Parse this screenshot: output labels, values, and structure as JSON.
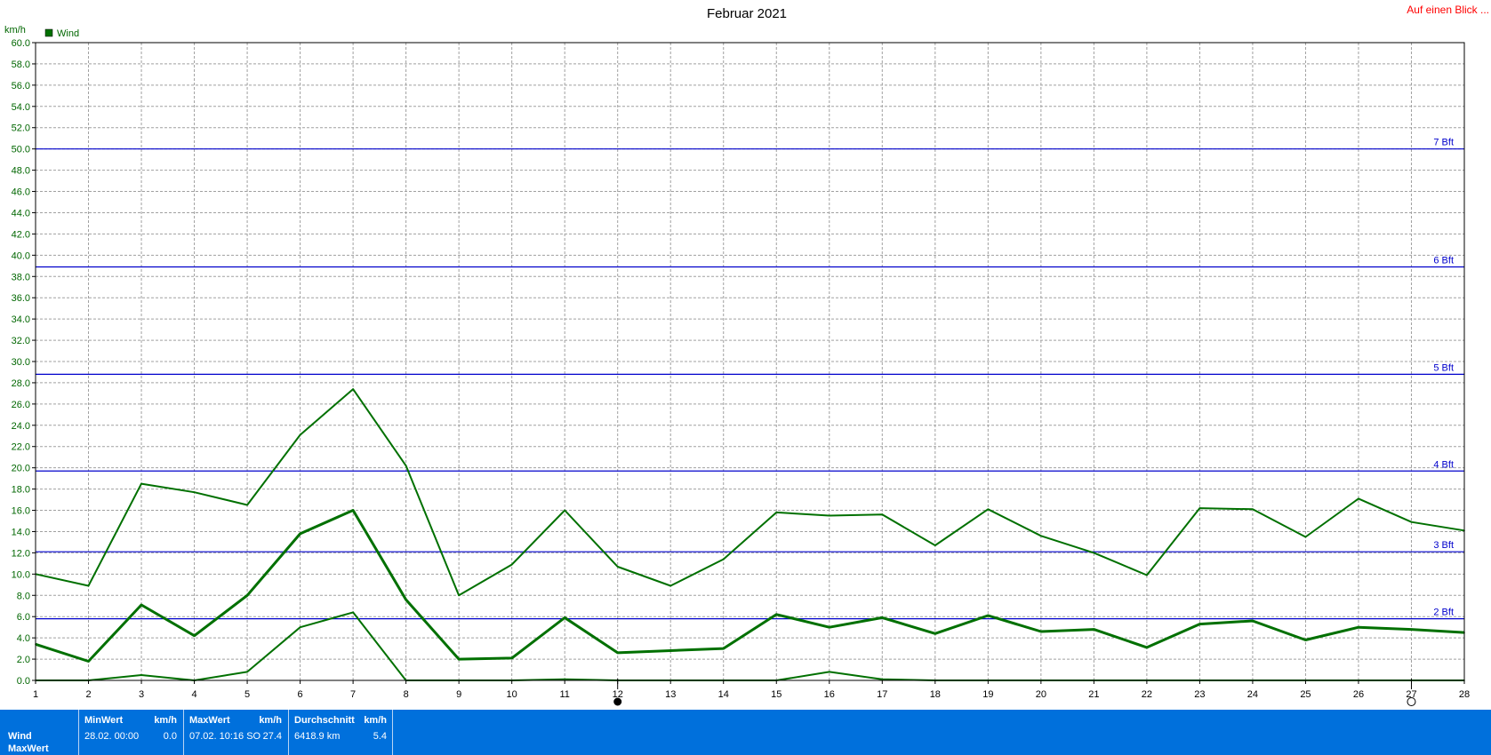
{
  "colors": {
    "series": "#007000",
    "grid": "#a0a0a0",
    "beaufort": "#0000cc",
    "axis_text": "#006600",
    "link": "#ff0000",
    "stats_bg": "#0070dc"
  },
  "header": {
    "link_label": "Auf einen Blick ..."
  },
  "chart_data": {
    "type": "line",
    "title": "Februar 2021",
    "ylabel": "km/h",
    "xlabel": "",
    "ylim": [
      0,
      60
    ],
    "ytick_step": 2,
    "x": [
      1,
      2,
      3,
      4,
      5,
      6,
      7,
      8,
      9,
      10,
      11,
      12,
      13,
      14,
      15,
      16,
      17,
      18,
      19,
      20,
      21,
      22,
      23,
      24,
      25,
      26,
      27,
      28
    ],
    "legend": {
      "entries": [
        "Wind"
      ],
      "position": "top-left"
    },
    "grid": true,
    "series": [
      {
        "role": "max",
        "values": [
          10.0,
          8.9,
          18.5,
          17.7,
          16.5,
          23.1,
          27.4,
          20.2,
          8.0,
          10.9,
          16.0,
          10.7,
          8.9,
          11.4,
          15.8,
          15.5,
          15.6,
          12.7,
          16.1,
          13.6,
          12.0,
          9.9,
          16.2,
          16.1,
          13.5,
          17.1,
          14.9,
          14.1
        ]
      },
      {
        "role": "avg",
        "values": [
          3.4,
          1.8,
          7.1,
          4.2,
          8.0,
          13.8,
          16.0,
          7.6,
          2.0,
          2.1,
          5.9,
          2.6,
          2.8,
          3.0,
          6.2,
          5.0,
          5.9,
          4.4,
          6.1,
          4.6,
          4.8,
          3.1,
          5.3,
          5.6,
          3.8,
          5.0,
          4.8,
          4.5
        ]
      },
      {
        "role": "min",
        "values": [
          0.0,
          0.0,
          0.5,
          0.0,
          0.8,
          5.0,
          6.4,
          0.0,
          0.0,
          0.0,
          0.1,
          0.0,
          0.0,
          0.0,
          0.0,
          0.8,
          0.1,
          0.0,
          0.0,
          0.0,
          0.0,
          0.0,
          0.0,
          0.0,
          0.0,
          0.0,
          0.0,
          0.0
        ]
      }
    ],
    "reference_lines": [
      {
        "value": 5.8,
        "label": "2 Bft"
      },
      {
        "value": 12.1,
        "label": "3 Bft"
      },
      {
        "value": 19.7,
        "label": "4 Bft"
      },
      {
        "value": 28.8,
        "label": "5 Bft"
      },
      {
        "value": 38.9,
        "label": "6 Bft"
      },
      {
        "value": 50.0,
        "label": "7 Bft"
      }
    ],
    "moon_phases": [
      {
        "x": 12,
        "phase": "full"
      },
      {
        "x": 27,
        "phase": "new"
      }
    ]
  },
  "stats": {
    "row_labels": [
      "Wind",
      "MaxWert"
    ],
    "min": {
      "header": "MinWert",
      "unit": "km/h",
      "date": "28.02.  00:00",
      "value": "0.0"
    },
    "max": {
      "header": "MaxWert",
      "unit": "km/h",
      "date": "07.02.  10:16 SO",
      "value": "27.4"
    },
    "avg": {
      "header": "Durchschnitt",
      "unit": "km/h",
      "date": "6418.9 km",
      "value": "5.4"
    }
  }
}
